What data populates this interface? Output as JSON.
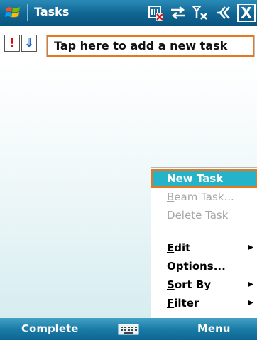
{
  "titlebar": {
    "title": "Tasks",
    "close_label": "X",
    "icons": [
      "windows-start-icon",
      "memory-card-icon",
      "connectivity-icon",
      "signal-off-icon",
      "volume-icon",
      "close-icon"
    ]
  },
  "entry": {
    "priority_high_label": "!",
    "priority_low_label": "⇓",
    "placeholder": "Tap here to add a new task"
  },
  "menu": {
    "items": [
      {
        "label": "New Task",
        "state": "selected"
      },
      {
        "label": "Beam Task...",
        "state": "disabled"
      },
      {
        "label": "Delete Task",
        "state": "disabled"
      },
      {
        "label": "Edit",
        "state": "enabled",
        "submenu": true
      },
      {
        "label": "Options...",
        "state": "enabled"
      },
      {
        "label": "Sort By",
        "state": "enabled",
        "submenu": true
      },
      {
        "label": "Filter",
        "state": "enabled",
        "submenu": true
      }
    ]
  },
  "softkeys": {
    "left": "Complete",
    "right": "Menu"
  },
  "colors": {
    "accent": "#0f6592",
    "highlight": "#24b3c9",
    "focus_border": "#e47720"
  }
}
